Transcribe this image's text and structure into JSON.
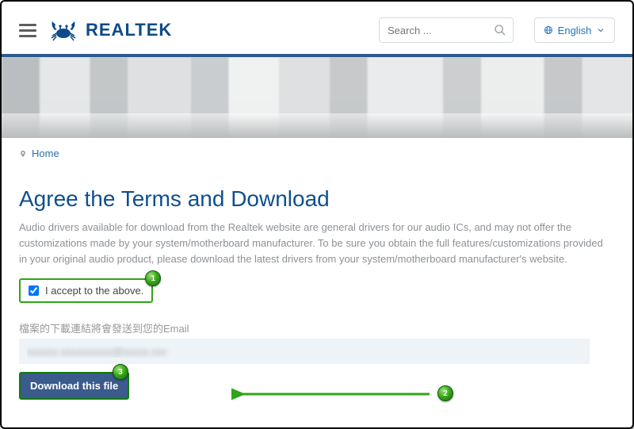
{
  "header": {
    "brand": "REALTEK",
    "search_placeholder": "Search ...",
    "language": "English"
  },
  "breadcrumb": {
    "home": "Home"
  },
  "page": {
    "title": "Agree the Terms and Download",
    "description": "Audio drivers available for download from the Realtek website are general drivers for our audio ICs, and may not offer the customizations made by your system/motherboard manufacturer. To be sure you obtain the full features/customizations provided in your original audio product, please download the latest drivers from your system/motherboard manufacturer's website.",
    "accept_label": "I accept to the above.",
    "email_caption": "檔案的下載連結將會發送到您的Email",
    "email_value": "",
    "download_label": "Download this file"
  },
  "annotations": {
    "a1": "1",
    "a2": "2",
    "a3": "3"
  }
}
